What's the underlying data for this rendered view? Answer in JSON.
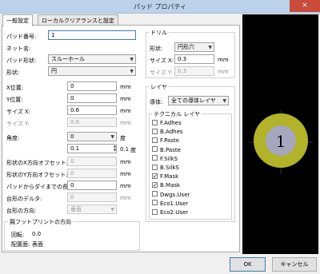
{
  "window": {
    "title": "パッド プロパティ",
    "close_icon": "×"
  },
  "tabs": [
    "一般設定",
    "ローカルクリアランスと設定"
  ],
  "general": {
    "pad_number": {
      "label": "パッド番号:",
      "value": "1"
    },
    "net_name": {
      "label": "ネット名:"
    },
    "pad_type": {
      "label": "パッド形状:",
      "value": "スルーホール"
    },
    "shape": {
      "label": "形状:",
      "value": "円"
    },
    "pos_x": {
      "label": "X位置:",
      "value": "0",
      "unit": "mm"
    },
    "pos_y": {
      "label": "Y位置:",
      "value": "0",
      "unit": "mm"
    },
    "size_x": {
      "label": "サイズ X:",
      "value": "0.6",
      "unit": "mm"
    },
    "size_y": {
      "label": "サイズ Y:",
      "value": "0.6",
      "unit": "mm"
    },
    "angle": {
      "label": "角度:",
      "value": "0",
      "unit": "度",
      "value2": "0.1",
      "unit2": "度"
    },
    "offset_x": {
      "label": "形状のX方向オフセット:",
      "value": "0",
      "unit": "mm"
    },
    "offset_y": {
      "label": "形状のY方向オフセット:",
      "value": "0",
      "unit": "mm"
    },
    "die_length": {
      "label": "パッドからダイまでの長さ:",
      "value": "0",
      "unit": "mm"
    },
    "trap_delta": {
      "label": "台形のデルタ:",
      "value": "0",
      "unit": "mm"
    },
    "trap_dir": {
      "label": "台形の方向:",
      "value": "垂直"
    },
    "footprint": {
      "heading": "親フットプリントの方向",
      "rotation_label": "回転:",
      "rotation_value": "0.0",
      "side_label": "配置面:",
      "side_value": "表面"
    }
  },
  "drill": {
    "heading": "ドリル",
    "shape_label": "形状:",
    "shape_value": "円形穴",
    "size_x_label": "サイズ X:",
    "size_x_value": "0.3",
    "size_x_unit": "mm",
    "size_y_label": "サイズ Y:",
    "size_y_value": "0.3",
    "size_y_unit": "mm"
  },
  "layers": {
    "heading": "レイヤ",
    "copper_label": "導体:",
    "copper_value": "全ての導体レイヤ",
    "technical_heading": "テクニカル レイヤ",
    "items": [
      {
        "label": "F.Adhes",
        "checked": false
      },
      {
        "label": "B.Adhes",
        "checked": false
      },
      {
        "label": "F.Paste",
        "checked": false
      },
      {
        "label": "B.Paste",
        "checked": false
      },
      {
        "label": "F.SilkS",
        "checked": false
      },
      {
        "label": "B.SilkS",
        "checked": false
      },
      {
        "label": "F.Mask",
        "checked": true
      },
      {
        "label": "B.Mask",
        "checked": true
      },
      {
        "label": "Dwgs.User",
        "checked": false
      },
      {
        "label": "Eco1.User",
        "checked": false
      },
      {
        "label": "Eco2.User",
        "checked": false
      }
    ]
  },
  "preview": {
    "pad_label": "1"
  },
  "buttons": {
    "ok": "OK",
    "cancel": "キャンセル"
  },
  "colors": {
    "pad_ring": "#b3b32a",
    "drill_hole": "#a6a6bf",
    "crosshair": "#3a3a90"
  }
}
